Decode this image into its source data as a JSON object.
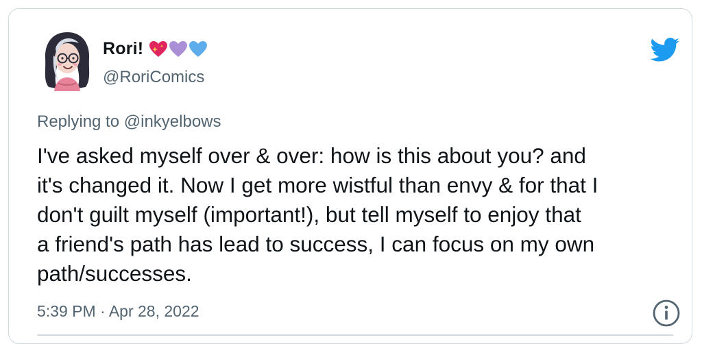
{
  "tweet": {
    "author": {
      "display_name": "Rori!",
      "handle": "@RoriComics",
      "avatar_icon": "illustrated-avatar-glasses-pink-hair",
      "name_emojis": [
        "sparkling-heart",
        "purple-heart",
        "blue-heart"
      ]
    },
    "brand_icon": "twitter-bird-icon",
    "replying_label": "Replying to",
    "replying_to": "@inkyelbows",
    "text": "I've asked myself over & over: how is this about you? and\nit's changed it. Now I get more wistful than envy & for that I\ndon't guilt myself (important!), but tell myself to enjoy that\na friend's path has lead to success, I can focus on my own\npath/successes.",
    "timestamp": "5:39 PM · Apr 28, 2022",
    "info_icon": "info-icon"
  },
  "colors": {
    "twitter_blue": "#1d9bf0",
    "secondary_text": "#536471",
    "primary_text": "#0f1419",
    "border": "#cfd9de",
    "heart_red": "#e0245e",
    "heart_purple": "#aa8ed6",
    "heart_blue": "#5dadec"
  }
}
